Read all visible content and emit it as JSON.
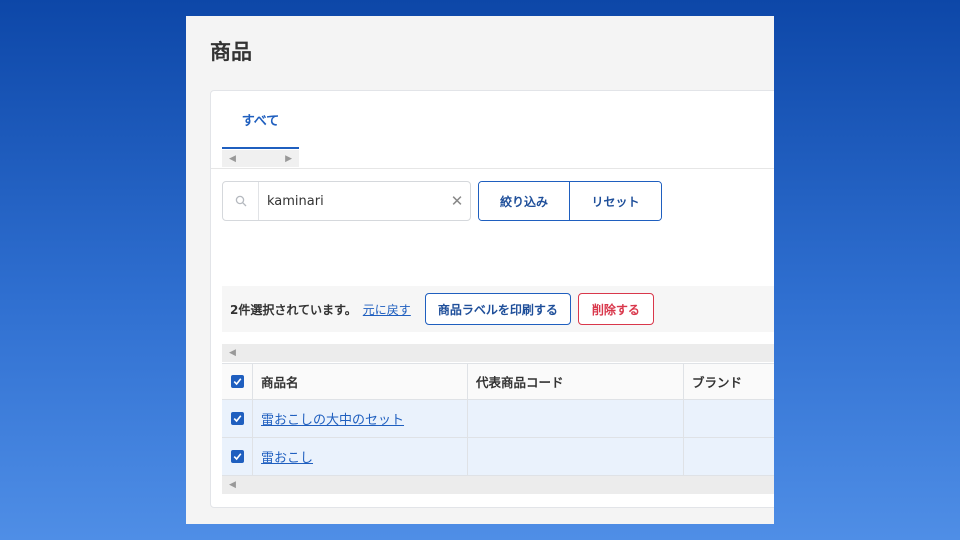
{
  "page": {
    "title": "商品"
  },
  "tabs": [
    {
      "label": "すべて",
      "active": true
    }
  ],
  "search": {
    "value": "kaminari",
    "placeholder": ""
  },
  "filter_buttons": {
    "filter_label": "絞り込み",
    "reset_label": "リセット"
  },
  "bulk_actions": {
    "selection_text": "2件選択されています。",
    "undo_label": "元に戻す",
    "print_label": "商品ラベルを印刷する",
    "delete_label": "削除する"
  },
  "table": {
    "columns": [
      "商品名",
      "代表商品コード",
      "ブランド"
    ],
    "rows": [
      {
        "name": "雷おこしの大中のセット",
        "code": "",
        "brand": "",
        "checked": true
      },
      {
        "name": "雷おこし",
        "code": "",
        "brand": "",
        "checked": true
      }
    ]
  },
  "colors": {
    "accent": "#1f5fbf",
    "danger": "#d9374b",
    "selected_row": "#eaf2fc"
  }
}
